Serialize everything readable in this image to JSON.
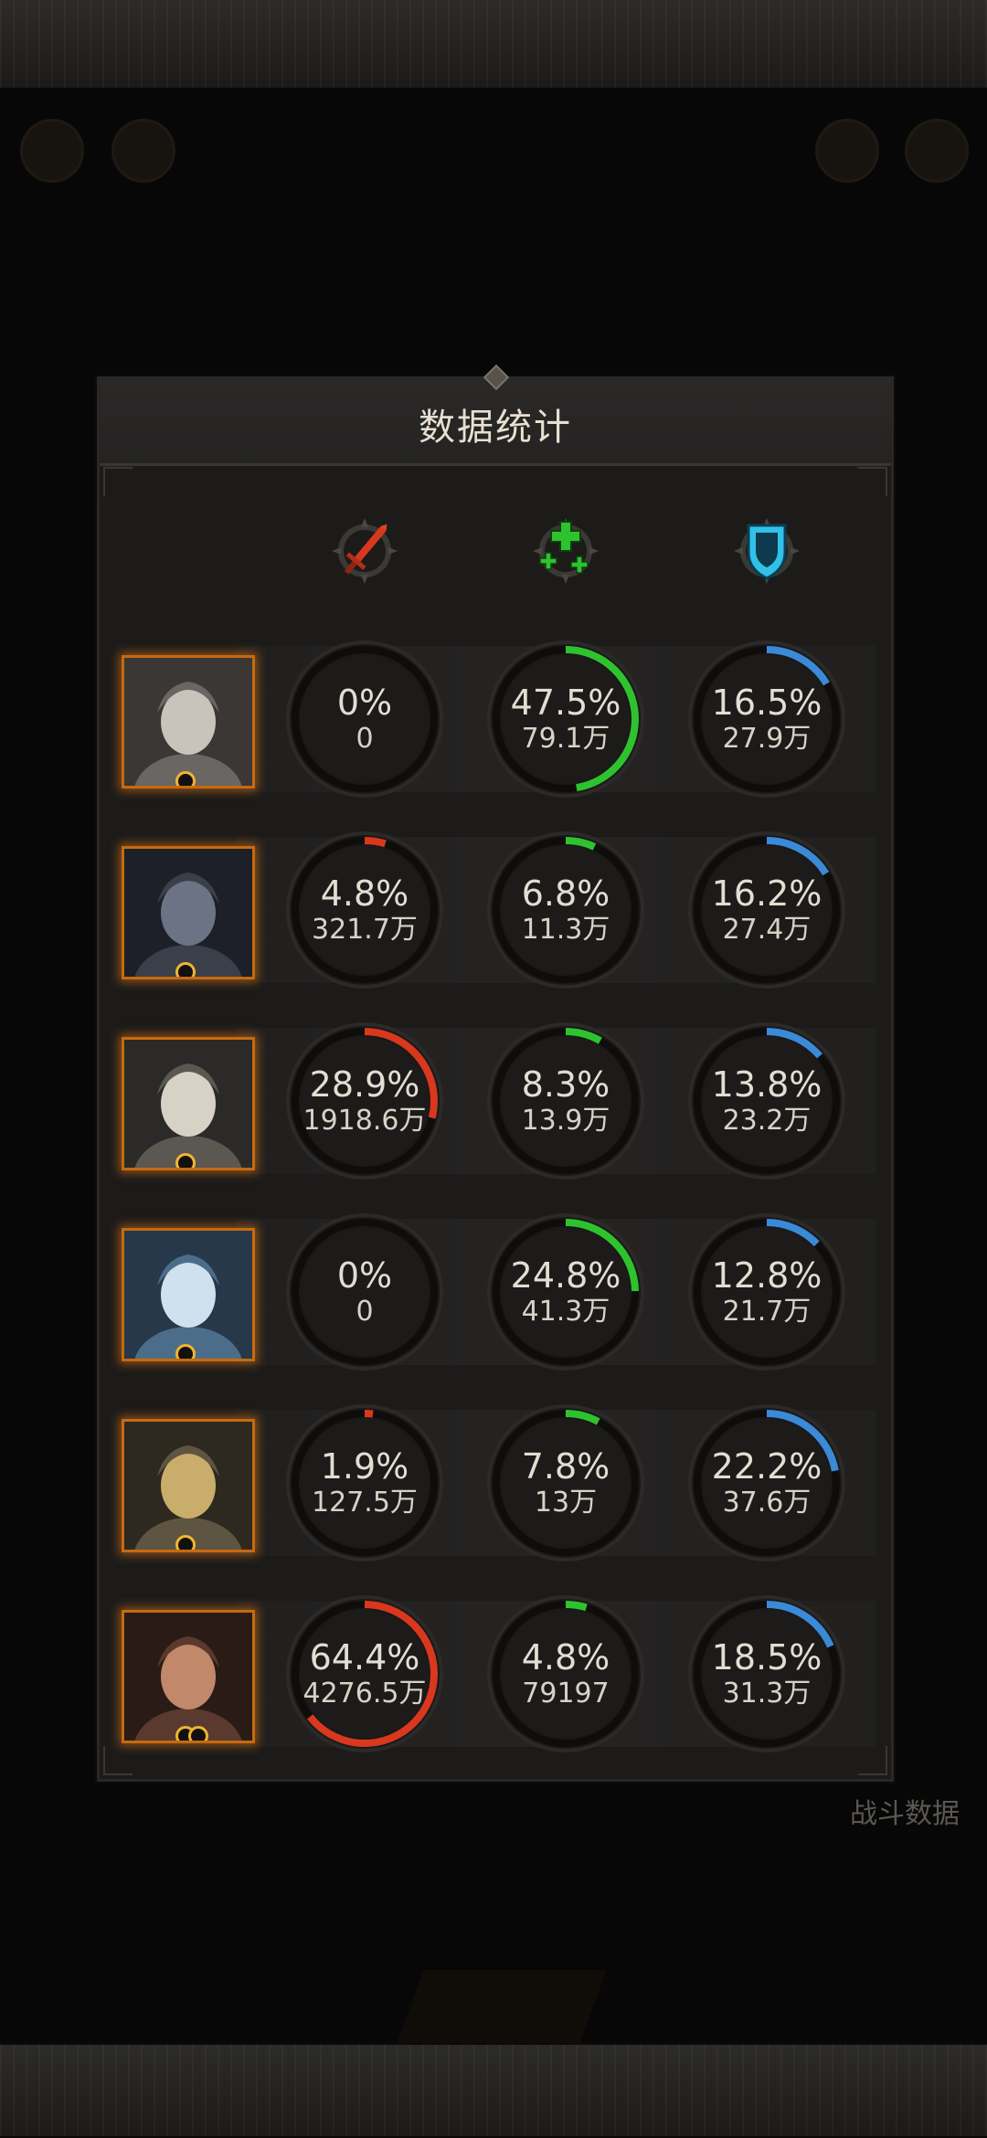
{
  "background": {
    "stats_button_label": "战斗数据"
  },
  "modal": {
    "title": "数据统计",
    "columns": [
      {
        "name": "damage",
        "icon": "sword-icon",
        "color": "#d9381e"
      },
      {
        "name": "healing",
        "icon": "heal-cross-icon",
        "color": "#2ec32e"
      },
      {
        "name": "damage-taken",
        "icon": "shield-icon",
        "color": "#3a8ad8"
      }
    ],
    "rows": [
      {
        "hero": "hero-portrait-1",
        "ranks": 1,
        "stats": [
          {
            "pct": "0%",
            "value": "0",
            "fraction": 0
          },
          {
            "pct": "47.5%",
            "value": "79.1万",
            "fraction": 0.475
          },
          {
            "pct": "16.5%",
            "value": "27.9万",
            "fraction": 0.165
          }
        ]
      },
      {
        "hero": "hero-portrait-2",
        "ranks": 1,
        "stats": [
          {
            "pct": "4.8%",
            "value": "321.7万",
            "fraction": 0.048
          },
          {
            "pct": "6.8%",
            "value": "11.3万",
            "fraction": 0.068
          },
          {
            "pct": "16.2%",
            "value": "27.4万",
            "fraction": 0.162
          }
        ]
      },
      {
        "hero": "hero-portrait-3",
        "ranks": 1,
        "stats": [
          {
            "pct": "28.9%",
            "value": "1918.6万",
            "fraction": 0.289
          },
          {
            "pct": "8.3%",
            "value": "13.9万",
            "fraction": 0.083
          },
          {
            "pct": "13.8%",
            "value": "23.2万",
            "fraction": 0.138
          }
        ]
      },
      {
        "hero": "hero-portrait-4",
        "ranks": 1,
        "stats": [
          {
            "pct": "0%",
            "value": "0",
            "fraction": 0
          },
          {
            "pct": "24.8%",
            "value": "41.3万",
            "fraction": 0.248
          },
          {
            "pct": "12.8%",
            "value": "21.7万",
            "fraction": 0.128
          }
        ]
      },
      {
        "hero": "hero-portrait-5",
        "ranks": 1,
        "stats": [
          {
            "pct": "1.9%",
            "value": "127.5万",
            "fraction": 0.019
          },
          {
            "pct": "7.8%",
            "value": "13万",
            "fraction": 0.078
          },
          {
            "pct": "22.2%",
            "value": "37.6万",
            "fraction": 0.222
          }
        ]
      },
      {
        "hero": "hero-portrait-6",
        "ranks": 2,
        "stats": [
          {
            "pct": "64.4%",
            "value": "4276.5万",
            "fraction": 0.644
          },
          {
            "pct": "4.8%",
            "value": "79197",
            "fraction": 0.048
          },
          {
            "pct": "18.5%",
            "value": "31.3万",
            "fraction": 0.185
          }
        ]
      }
    ]
  }
}
